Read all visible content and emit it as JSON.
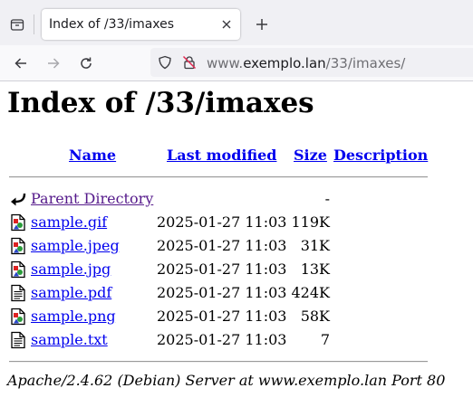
{
  "browser": {
    "tab_title": "Index of /33/imaxes",
    "url_prefix": "www.",
    "url_host": "exemplo.lan",
    "url_path": "/33/imaxes/"
  },
  "page": {
    "heading": "Index of /33/imaxes",
    "columns": {
      "name": "Name",
      "modified": "Last modified",
      "size": "Size",
      "description": "Description"
    },
    "parent": {
      "label": "Parent Directory",
      "size": "-",
      "icon": "back-arrow-icon"
    },
    "files": [
      {
        "name": "sample.gif",
        "modified": "2025-01-27 11:03",
        "size": "119K",
        "icon": "image-file-icon"
      },
      {
        "name": "sample.jpeg",
        "modified": "2025-01-27 11:03",
        "size": "31K",
        "icon": "image-file-icon"
      },
      {
        "name": "sample.jpg",
        "modified": "2025-01-27 11:03",
        "size": "13K",
        "icon": "image-file-icon"
      },
      {
        "name": "sample.pdf",
        "modified": "2025-01-27 11:03",
        "size": "424K",
        "icon": "text-file-icon"
      },
      {
        "name": "sample.png",
        "modified": "2025-01-27 11:03",
        "size": "58K",
        "icon": "image-file-icon"
      },
      {
        "name": "sample.txt",
        "modified": "2025-01-27 11:03",
        "size": "7",
        "icon": "text-file-icon"
      }
    ],
    "footer": "Apache/2.4.62 (Debian) Server at www.exemplo.lan Port 80"
  },
  "colors": {
    "link": "#0000ee",
    "visited": "#551a8b",
    "chrome_bg": "#f0f0f4"
  }
}
